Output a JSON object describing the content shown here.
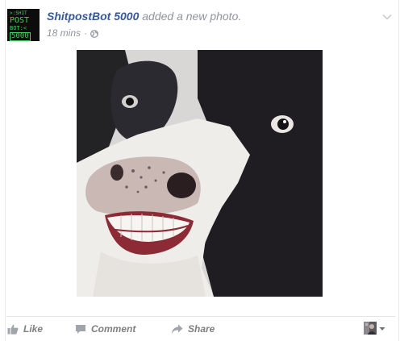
{
  "post": {
    "author": "ShitpostBot 5000",
    "action_text": " added a new photo.",
    "timestamp": "18 mins",
    "separator": "·",
    "privacy_icon": "globe-icon",
    "options_icon": "chevron-down-icon"
  },
  "avatar": {
    "lines": [
      ">:SHIT",
      "POST",
      "BOT:<",
      "5000"
    ],
    "text_color": "#3fd45b",
    "bg_color": "#0c0c0c"
  },
  "photo": {
    "subject": "cow-with-human-smile"
  },
  "actions": {
    "like_label": "Like",
    "comment_label": "Comment",
    "share_label": "Share",
    "like_icon": "thumbs-up-icon",
    "comment_icon": "comment-bubble-icon",
    "share_icon": "share-arrow-icon",
    "audience_icon": "dropdown-triangle-icon"
  },
  "colors": {
    "author_blue": "#365899",
    "meta_gray": "#90949c",
    "action_gray": "#7f7f7f"
  }
}
